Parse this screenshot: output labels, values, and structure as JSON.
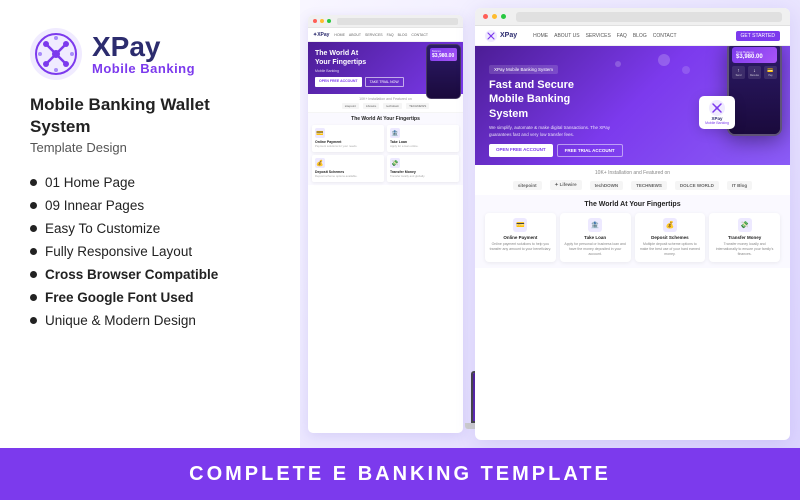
{
  "logo": {
    "brand": "XPay",
    "sub": "Mobile Banking",
    "icon_color": "#7c3aed"
  },
  "product": {
    "title": "Mobile Banking Wallet System",
    "subtitle": "Template Design"
  },
  "features": [
    {
      "text": "01 Home Page"
    },
    {
      "text": "09 Innear Pages"
    },
    {
      "text": "Easy To Customize"
    },
    {
      "text": "Fully Responsive Layout"
    },
    {
      "text": "Cross Browser Compatible"
    },
    {
      "text": "Free Google Font Used"
    },
    {
      "text": "Unique & Modern Design"
    }
  ],
  "bottom_banner": {
    "text": "COMPLETE E BANKING TEMPLATE"
  },
  "preview": {
    "hero_badge": "XPay Mobile Banking System",
    "hero_title": "Fast and Secure\nMobile Banking System",
    "hero_desc": "We simplify, automate & make digital transactions. The XPay guarantees fast and very low transfer fees.",
    "btn_primary": "OPEN FREE ACCOUNT",
    "btn_secondary": "FREE TRIAL ACCOUNT",
    "featured_text": "10K+ Installation and Featured on",
    "featured_logos": [
      "sitepoint",
      "Lifewire",
      "TECHDOWN",
      "TECHNEWS",
      "DOLCE WORLD",
      "IT Blog"
    ],
    "services_title": "The World At Your Fingertips",
    "services": [
      {
        "title": "Online Payment",
        "icon": "💳",
        "desc": "Online payment solutions to help you transfer any amount to your beneficiary."
      },
      {
        "title": "Take Loan",
        "icon": "🏦",
        "desc": "Apply for personal or business loan and have the money deposited in your account."
      },
      {
        "title": "Deposit Schemes",
        "icon": "💰",
        "desc": "Multiple deposit scheme options to make the best use of your hard earned money."
      },
      {
        "title": "Transfer Money",
        "icon": "💸",
        "desc": "Transfer money locally and internationally to ensure your family's finances."
      }
    ]
  },
  "small_preview": {
    "nav_brand": "✦XPay",
    "nav_links": [
      "HOME",
      "ABOUT US",
      "SERVICES",
      "FAQ",
      "BLOG",
      "CONTACT"
    ],
    "hero_title": "The World At\nYour Fingertips",
    "hero_sub": "Mobile Banking",
    "btn1": "OPEN FREE ACCOUNT",
    "btn2": "TAKE TRIAL NOW",
    "featured_text": "10K+ Installation and Featured on",
    "featured_items": [
      "sitepoint",
      "Lifewire",
      "techdown"
    ],
    "services_title": "The World At Your Fingertips",
    "cards": [
      {
        "title": "Online Payment",
        "icon": "💳"
      },
      {
        "title": "Take Loan",
        "icon": "🏦"
      },
      {
        "title": "Deposit Schemes",
        "icon": "💰"
      },
      {
        "title": "Transfer Money",
        "icon": "💸"
      }
    ]
  }
}
